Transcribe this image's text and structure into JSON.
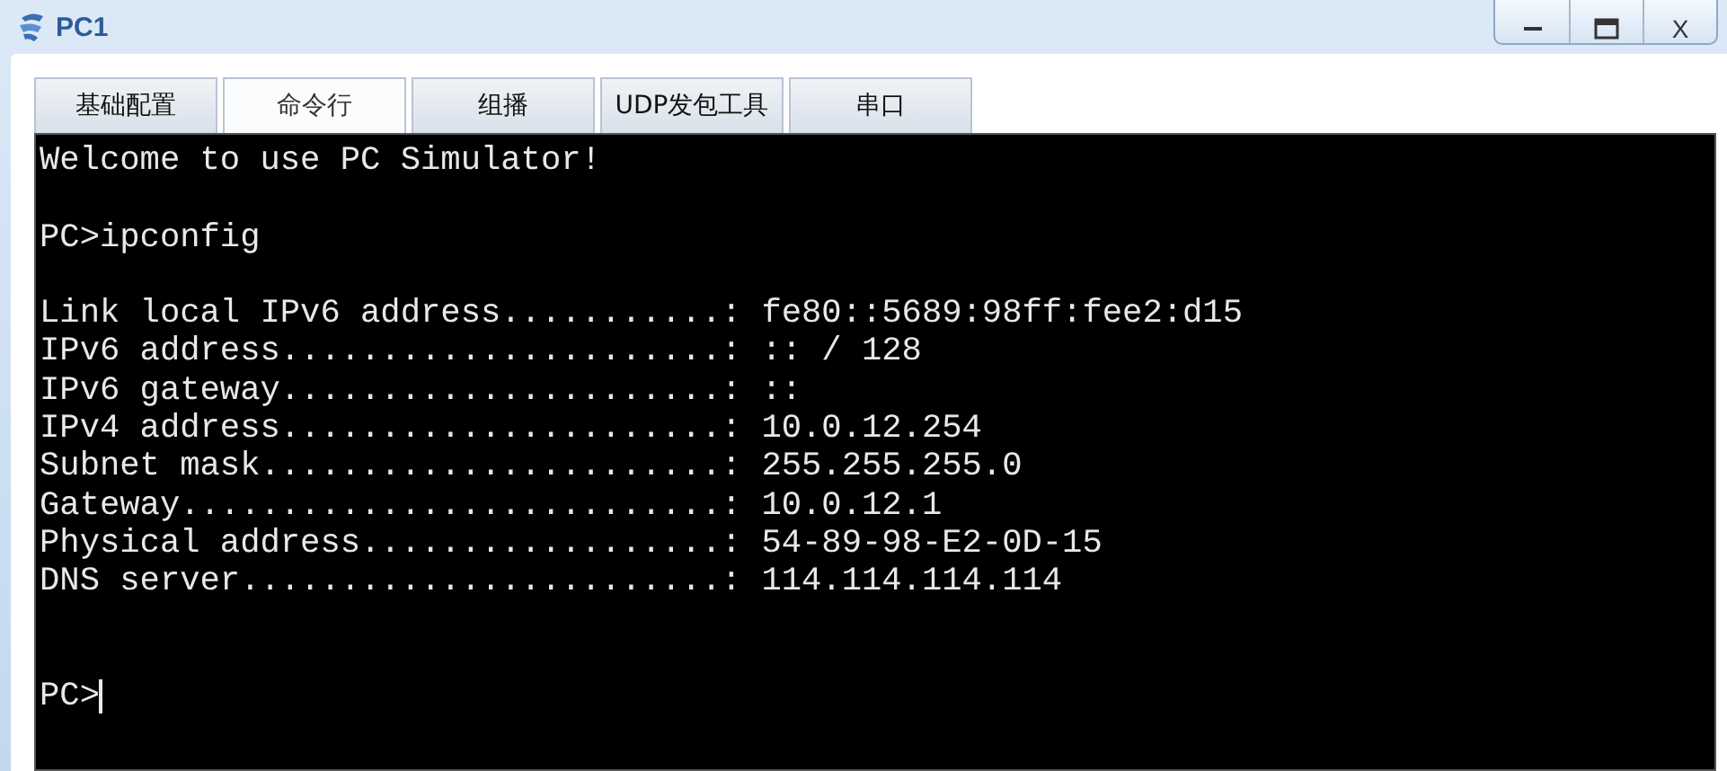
{
  "window": {
    "title": "PC1",
    "controls": [
      {
        "kind": "minimize"
      },
      {
        "kind": "maximize"
      },
      {
        "kind": "close",
        "label": "X"
      }
    ]
  },
  "tabs": [
    {
      "label": "基础配置",
      "selected": false
    },
    {
      "label": "命令行",
      "selected": true
    },
    {
      "label": "组播",
      "selected": false
    },
    {
      "label": "UDP发包工具",
      "selected": false
    },
    {
      "label": "串口",
      "selected": false
    }
  ],
  "terminal": {
    "lines": [
      {
        "kind": "text",
        "text": "Welcome to use PC Simulator!"
      },
      {
        "kind": "blank"
      },
      {
        "kind": "text",
        "text": "PC>ipconfig"
      },
      {
        "kind": "blank"
      },
      {
        "kind": "text",
        "text": "Link local IPv6 address...........: fe80::5689:98ff:fee2:d15"
      },
      {
        "kind": "text",
        "text": "IPv6 address......................: :: / 128"
      },
      {
        "kind": "text",
        "text": "IPv6 gateway......................: ::"
      },
      {
        "kind": "text",
        "text": "IPv4 address......................: 10.0.12.254"
      },
      {
        "kind": "text",
        "text": "Subnet mask.......................: 255.255.255.0"
      },
      {
        "kind": "text",
        "text": "Gateway...........................: 10.0.12.1"
      },
      {
        "kind": "text",
        "text": "Physical address..................: 54-89-98-E2-0D-15"
      },
      {
        "kind": "text",
        "text": "DNS server........................: 114.114.114.114"
      },
      {
        "kind": "blank"
      },
      {
        "kind": "blank"
      },
      {
        "kind": "prompt",
        "text": "PC>",
        "cursor": true
      }
    ]
  }
}
